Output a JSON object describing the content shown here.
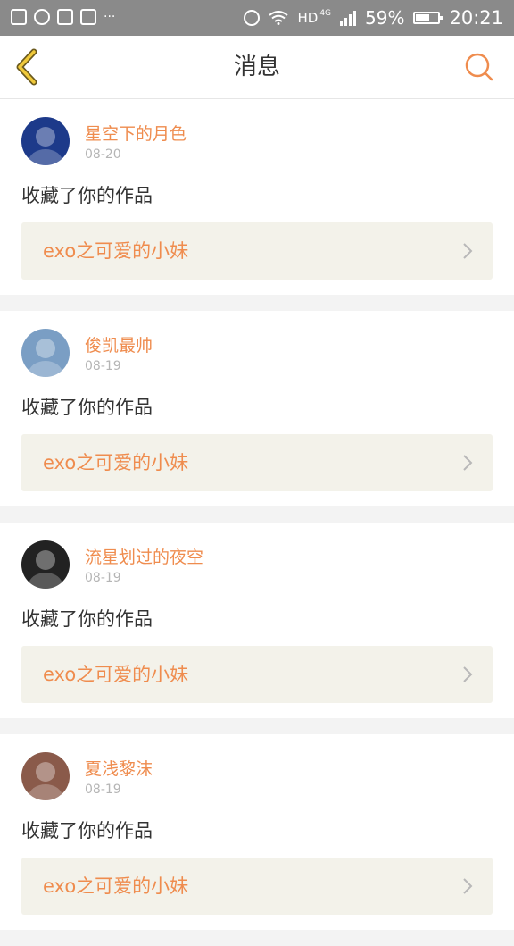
{
  "status_bar": {
    "hd": "HD",
    "network": "4G",
    "battery_percent": "59%",
    "battery_level": 0.59,
    "time": "20:21",
    "more": "···"
  },
  "nav": {
    "title": "消息",
    "accent_color": "#ef8c4e"
  },
  "messages": [
    {
      "name": "星空下的月色",
      "date": "08-20",
      "action": "收藏了你的作品",
      "work": "exo之可爱的小妹",
      "avatar_color": "#1d3a8a"
    },
    {
      "name": "俊凯最帅",
      "date": "08-19",
      "action": "收藏了你的作品",
      "work": "exo之可爱的小妹",
      "avatar_color": "#7a9ec4"
    },
    {
      "name": "流星划过的夜空",
      "date": "08-19",
      "action": "收藏了你的作品",
      "work": "exo之可爱的小妹",
      "avatar_color": "#222222"
    },
    {
      "name": "夏浅黎沫",
      "date": "08-19",
      "action": "收藏了你的作品",
      "work": "exo之可爱的小妹",
      "avatar_color": "#8a5a4a"
    }
  ]
}
